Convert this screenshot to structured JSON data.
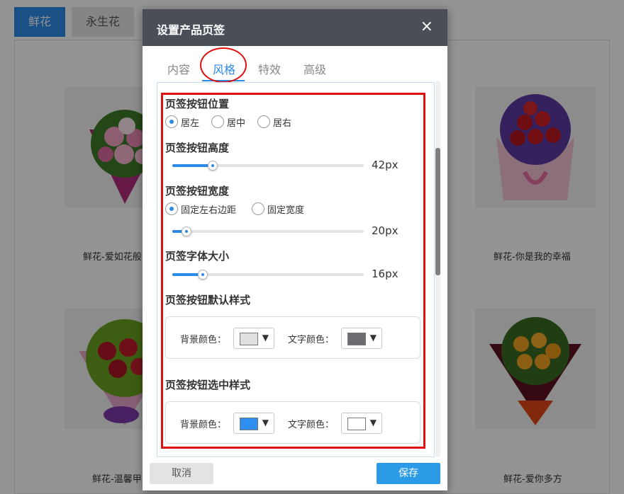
{
  "background": {
    "tabs": [
      {
        "label": "鲜花",
        "active": true
      },
      {
        "label": "永生花",
        "active": false
      }
    ],
    "products": [
      {
        "name": "鲜花-爱如花般"
      },
      {
        "name": "鲜花-你是我的幸福"
      },
      {
        "name": "鲜花-温馨甲"
      },
      {
        "name": "鲜花-爱你多方"
      }
    ]
  },
  "dialog": {
    "title": "设置产品页签",
    "close_icon": "×",
    "tabs": [
      {
        "label": "内容",
        "active": false
      },
      {
        "label": "风格",
        "active": true
      },
      {
        "label": "特效",
        "active": false
      },
      {
        "label": "高级",
        "active": false
      }
    ],
    "sections": {
      "position": {
        "title": "页签按钮位置",
        "options": [
          "居左",
          "居中",
          "居右"
        ],
        "selected": "居左"
      },
      "height": {
        "title": "页签按钮高度",
        "value_text": "42px",
        "fraction": 0.21
      },
      "width": {
        "title": "页签按钮宽度",
        "options": [
          "固定左右边距",
          "固定宽度"
        ],
        "selected": "固定左右边距",
        "value_text": "20px",
        "fraction": 0.075
      },
      "font_size": {
        "title": "页签字体大小",
        "value_text": "16px",
        "fraction": 0.16
      },
      "default_style": {
        "title": "页签按钮默认样式",
        "bg_label": "背景颜色：",
        "bg_color": "#e0e0e0",
        "text_label": "文字颜色：",
        "text_color": "#6b6b70"
      },
      "selected_style": {
        "title": "页签按钮选中样式",
        "bg_label": "背景颜色：",
        "bg_color": "#2f8ff0",
        "text_label": "文字颜色：",
        "text_color": "#ffffff"
      }
    },
    "footer": {
      "cancel_label": "取消",
      "save_label": "保存"
    }
  },
  "colors": {
    "accent": "#2b8ae6",
    "annotation": "#e01010",
    "header_bg": "#4a4f57"
  }
}
